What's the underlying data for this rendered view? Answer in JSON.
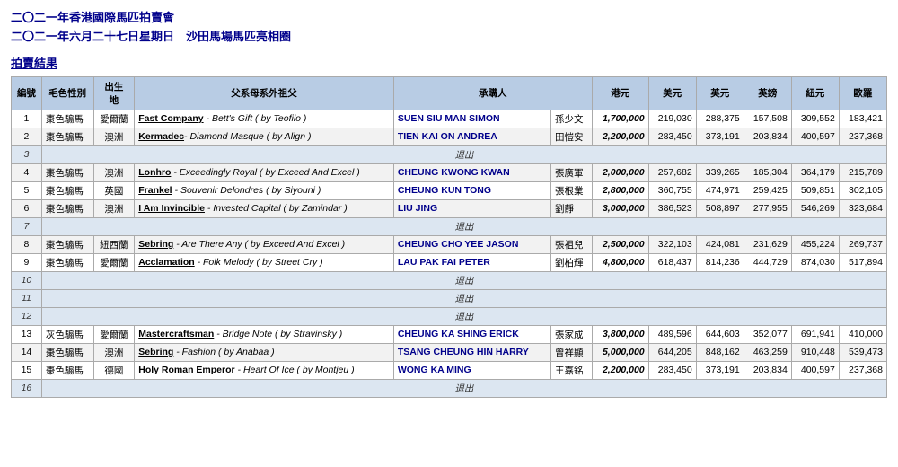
{
  "header": {
    "line1": "二〇二一年香港國際馬匹拍賣會",
    "line2": "二〇二一年六月二十七日星期日　沙田馬場馬匹亮相圈",
    "section": "拍賣結果"
  },
  "columns": [
    "編號",
    "毛色性別",
    "出生地",
    "父系母系外祖父",
    "承購人",
    "",
    "港元",
    "美元",
    "英元",
    "英鎊",
    "紐元",
    "歐羅"
  ],
  "rows": [
    {
      "id": "1",
      "coat": "棗色騸馬",
      "origin": "愛爾蘭",
      "lineage_bold": "Fast Company",
      "lineage_rest": " - Bett's Gift ( by Teofilo )",
      "buyer_en": "SUEN SIU MAN SIMON",
      "buyer_cn": "孫少文",
      "hkd": "1,700,000",
      "usd": "219,030",
      "gbp_en": "288,375",
      "gbp": "157,508",
      "nzd": "309,552",
      "eur": "183,421",
      "withdrawn": false
    },
    {
      "id": "2",
      "coat": "棗色騸馬",
      "origin": "澳洲",
      "lineage_bold": "Kermadec",
      "lineage_rest": "- Diamond Masque ( by Align )",
      "buyer_en": "TIEN KAI ON ANDREA",
      "buyer_cn": "田愷安",
      "hkd": "2,200,000",
      "usd": "283,450",
      "gbp_en": "373,191",
      "gbp": "203,834",
      "nzd": "400,597",
      "eur": "237,368",
      "withdrawn": false
    },
    {
      "id": "3",
      "coat": "",
      "origin": "",
      "lineage_bold": "",
      "lineage_rest": "",
      "buyer_en": "",
      "buyer_cn": "",
      "hkd": "",
      "usd": "",
      "gbp_en": "",
      "gbp": "",
      "nzd": "",
      "eur": "",
      "withdrawn": true,
      "withdrawn_text": "退出"
    },
    {
      "id": "4",
      "coat": "棗色騸馬",
      "origin": "澳洲",
      "lineage_bold": "Lonhro",
      "lineage_rest": " - Exceedingly Royal ( by Exceed And Excel )",
      "buyer_en": "CHEUNG KWONG KWAN",
      "buyer_cn": "張廣軍",
      "hkd": "2,000,000",
      "usd": "257,682",
      "gbp_en": "339,265",
      "gbp": "185,304",
      "nzd": "364,179",
      "eur": "215,789",
      "withdrawn": false
    },
    {
      "id": "5",
      "coat": "棗色騸馬",
      "origin": "英國",
      "lineage_bold": "Frankel",
      "lineage_rest": " - Souvenir Delondres ( by Siyouni )",
      "buyer_en": "CHEUNG KUN TONG",
      "buyer_cn": "張根業",
      "hkd": "2,800,000",
      "usd": "360,755",
      "gbp_en": "474,971",
      "gbp": "259,425",
      "nzd": "509,851",
      "eur": "302,105",
      "withdrawn": false
    },
    {
      "id": "6",
      "coat": "棗色騸馬",
      "origin": "澳洲",
      "lineage_bold": "I Am Invincible",
      "lineage_rest": " - Invested Capital ( by Zamindar )",
      "buyer_en": "LIU JING",
      "buyer_cn": "劉靜",
      "hkd": "3,000,000",
      "usd": "386,523",
      "gbp_en": "508,897",
      "gbp": "277,955",
      "nzd": "546,269",
      "eur": "323,684",
      "withdrawn": false
    },
    {
      "id": "7",
      "coat": "",
      "origin": "",
      "lineage_bold": "",
      "lineage_rest": "",
      "buyer_en": "",
      "buyer_cn": "",
      "hkd": "",
      "usd": "",
      "gbp_en": "",
      "gbp": "",
      "nzd": "",
      "eur": "",
      "withdrawn": true,
      "withdrawn_text": "退出"
    },
    {
      "id": "8",
      "coat": "棗色騸馬",
      "origin": "紐西蘭",
      "lineage_bold": "Sebring",
      "lineage_rest": " - Are There Any ( by Exceed And Excel )",
      "buyer_en": "CHEUNG CHO YEE JASON",
      "buyer_cn": "張祖兒",
      "hkd": "2,500,000",
      "usd": "322,103",
      "gbp_en": "424,081",
      "gbp": "231,629",
      "nzd": "455,224",
      "eur": "269,737",
      "withdrawn": false
    },
    {
      "id": "9",
      "coat": "棗色騸馬",
      "origin": "愛爾蘭",
      "lineage_bold": "Acclamation",
      "lineage_rest": " - Folk Melody ( by Street Cry )",
      "buyer_en": "LAU PAK FAI PETER",
      "buyer_cn": "劉柏輝",
      "hkd": "4,800,000",
      "usd": "618,437",
      "gbp_en": "814,236",
      "gbp": "444,729",
      "nzd": "874,030",
      "eur": "517,894",
      "withdrawn": false
    },
    {
      "id": "10",
      "coat": "",
      "origin": "",
      "lineage_bold": "",
      "lineage_rest": "",
      "buyer_en": "",
      "buyer_cn": "",
      "hkd": "",
      "usd": "",
      "gbp_en": "",
      "gbp": "",
      "nzd": "",
      "eur": "",
      "withdrawn": true,
      "withdrawn_text": "退出"
    },
    {
      "id": "11",
      "coat": "",
      "origin": "",
      "lineage_bold": "",
      "lineage_rest": "",
      "buyer_en": "",
      "buyer_cn": "",
      "hkd": "",
      "usd": "",
      "gbp_en": "",
      "gbp": "",
      "nzd": "",
      "eur": "",
      "withdrawn": true,
      "withdrawn_text": "退出"
    },
    {
      "id": "12",
      "coat": "",
      "origin": "",
      "lineage_bold": "",
      "lineage_rest": "",
      "buyer_en": "",
      "buyer_cn": "",
      "hkd": "",
      "usd": "",
      "gbp_en": "",
      "gbp": "",
      "nzd": "",
      "eur": "",
      "withdrawn": true,
      "withdrawn_text": "退出"
    },
    {
      "id": "13",
      "coat": "灰色騸馬",
      "origin": "愛爾蘭",
      "lineage_bold": "Mastercraftsman",
      "lineage_rest": " - Bridge Note ( by Stravinsky )",
      "buyer_en": "CHEUNG KA SHING ERICK",
      "buyer_cn": "張家成",
      "hkd": "3,800,000",
      "usd": "489,596",
      "gbp_en": "644,603",
      "gbp": "352,077",
      "nzd": "691,941",
      "eur": "410,000",
      "withdrawn": false
    },
    {
      "id": "14",
      "coat": "棗色騸馬",
      "origin": "澳洲",
      "lineage_bold": "Sebring",
      "lineage_rest": " - Fashion ( by Anabaa )",
      "buyer_en": "TSANG CHEUNG HIN HARRY",
      "buyer_cn": "曾祥顯",
      "hkd": "5,000,000",
      "usd": "644,205",
      "gbp_en": "848,162",
      "gbp": "463,259",
      "nzd": "910,448",
      "eur": "539,473",
      "withdrawn": false
    },
    {
      "id": "15",
      "coat": "棗色騸馬",
      "origin": "德國",
      "lineage_bold": "Holy Roman Emperor",
      "lineage_rest": " - Heart Of Ice ( by Montjeu )",
      "buyer_en": "WONG KA MING",
      "buyer_cn": "王嘉銘",
      "hkd": "2,200,000",
      "usd": "283,450",
      "gbp_en": "373,191",
      "gbp": "203,834",
      "nzd": "400,597",
      "eur": "237,368",
      "withdrawn": false
    },
    {
      "id": "16",
      "coat": "",
      "origin": "",
      "lineage_bold": "",
      "lineage_rest": "",
      "buyer_en": "",
      "buyer_cn": "",
      "hkd": "",
      "usd": "",
      "gbp_en": "",
      "gbp": "",
      "nzd": "",
      "eur": "",
      "withdrawn": true,
      "withdrawn_text": "退出"
    }
  ]
}
